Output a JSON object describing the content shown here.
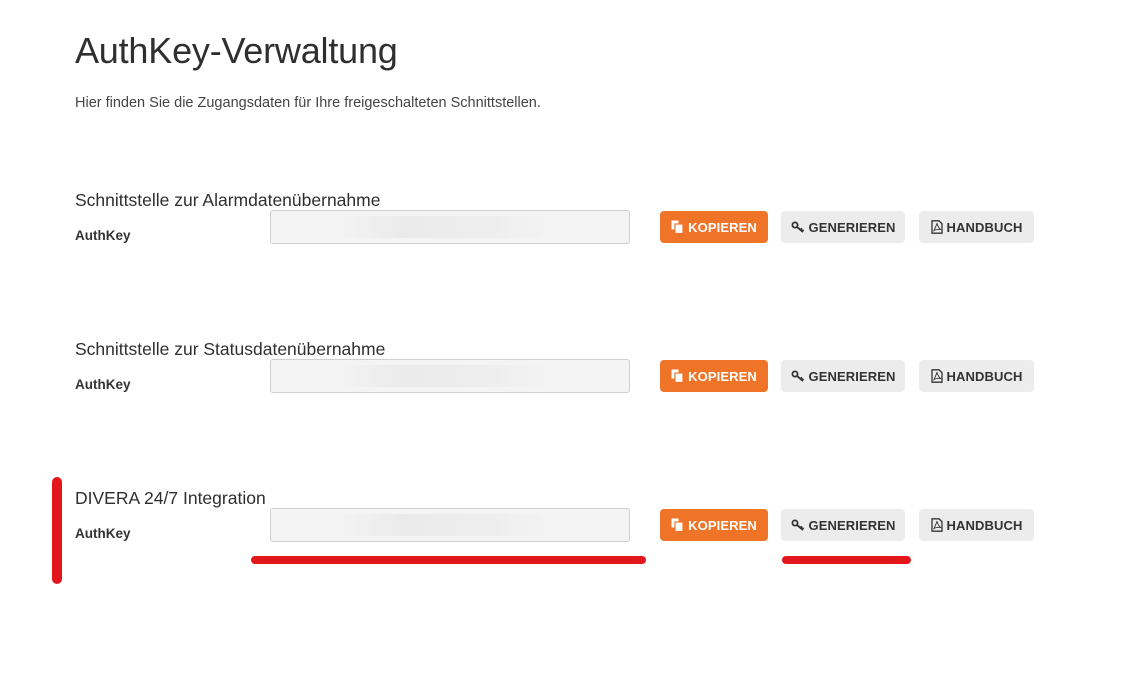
{
  "page": {
    "title": "AuthKey-Verwaltung",
    "subtitle": "Hier finden Sie die Zugangsdaten für Ihre freigeschalteten Schnittstellen."
  },
  "sections": [
    {
      "heading": "Schnittstelle zur Alarmdatenübernahme",
      "label": "AuthKey",
      "value": "",
      "copy_label": "KOPIEREN",
      "generate_label": "GENERIEREN",
      "manual_label": "HANDBUCH"
    },
    {
      "heading": "Schnittstelle zur Statusdatenübernahme",
      "label": "AuthKey",
      "value": "",
      "copy_label": "KOPIEREN",
      "generate_label": "GENERIEREN",
      "manual_label": "HANDBUCH"
    },
    {
      "heading": "DIVERA 24/7 Integration",
      "label": "AuthKey",
      "value": "",
      "copy_label": "KOPIEREN",
      "generate_label": "GENERIEREN",
      "manual_label": "HANDBUCH"
    }
  ],
  "icons": {
    "copy": "copy-icon",
    "generate": "key-icon",
    "manual": "pdf-file-icon"
  },
  "colors": {
    "accent": "#f07428",
    "secondary_button": "#ececec",
    "highlight": "#e2161b"
  }
}
